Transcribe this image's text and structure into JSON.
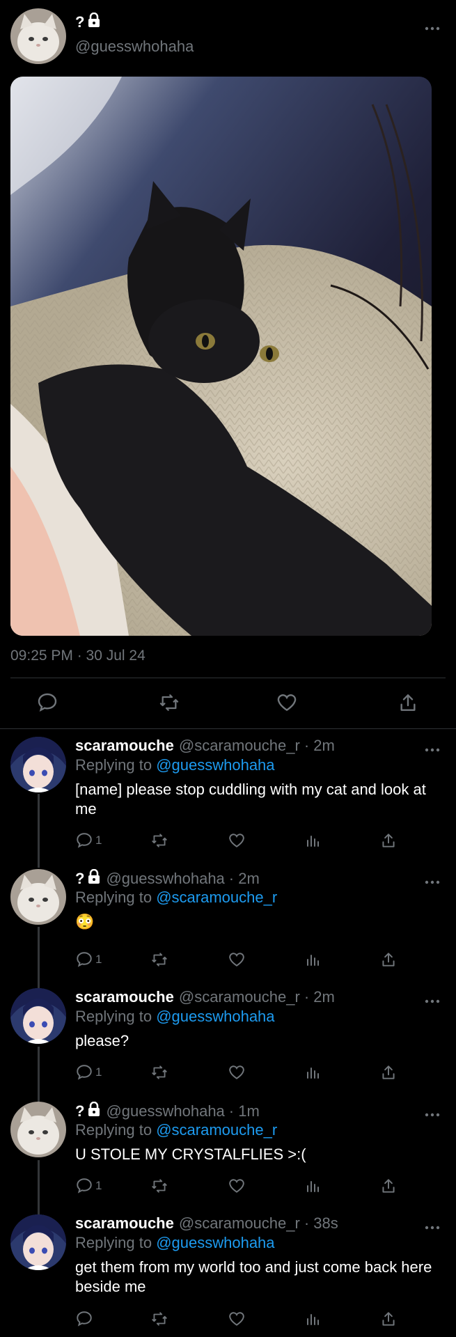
{
  "main_tweet": {
    "display_name": "?",
    "handle": "@guesswhohaha",
    "timestamp": "09:25 PM · 30 Jul 24"
  },
  "replies": [
    {
      "name": "scaramouche",
      "handle": "@scaramouche_r",
      "time": "· 2m",
      "replying_prefix": "Replying to ",
      "replying_to": "@guesswhohaha",
      "text": "[name] please stop cuddling with my cat and look at me",
      "reply_count": "1",
      "avatar": "scaramouche"
    },
    {
      "name": "?",
      "locked": true,
      "handle": "@guesswhohaha",
      "time": "· 2m",
      "replying_prefix": "Replying to ",
      "replying_to": "@scaramouche_r",
      "text": "😳",
      "reply_count": "1",
      "avatar": "cat"
    },
    {
      "name": "scaramouche",
      "handle": "@scaramouche_r",
      "time": "· 2m",
      "replying_prefix": "Replying to ",
      "replying_to": "@guesswhohaha",
      "text": "please?",
      "reply_count": "1",
      "avatar": "scaramouche"
    },
    {
      "name": "?",
      "locked": true,
      "handle": "@guesswhohaha",
      "time": "· 1m",
      "replying_prefix": "Replying to ",
      "replying_to": "@scaramouche_r",
      "text": "U STOLE MY CRYSTALFLIES >:(",
      "reply_count": "1",
      "avatar": "cat"
    },
    {
      "name": "scaramouche",
      "handle": "@scaramouche_r",
      "time": "· 38s",
      "replying_prefix": "Replying to ",
      "replying_to": "@guesswhohaha",
      "text": "get them from my world too and just come back here beside me",
      "reply_count": "",
      "avatar": "scaramouche"
    }
  ],
  "icons": {
    "more": "more-horizontal-icon",
    "reply": "reply-bubble-icon",
    "retweet": "retweet-icon",
    "like": "heart-icon",
    "views": "views-chart-icon",
    "share": "share-icon",
    "lock": "lock-icon"
  },
  "colors": {
    "background": "#000000",
    "text": "#e7e9ea",
    "secondary": "#71767b",
    "link": "#1d9bf0",
    "divider": "#2f3336"
  }
}
